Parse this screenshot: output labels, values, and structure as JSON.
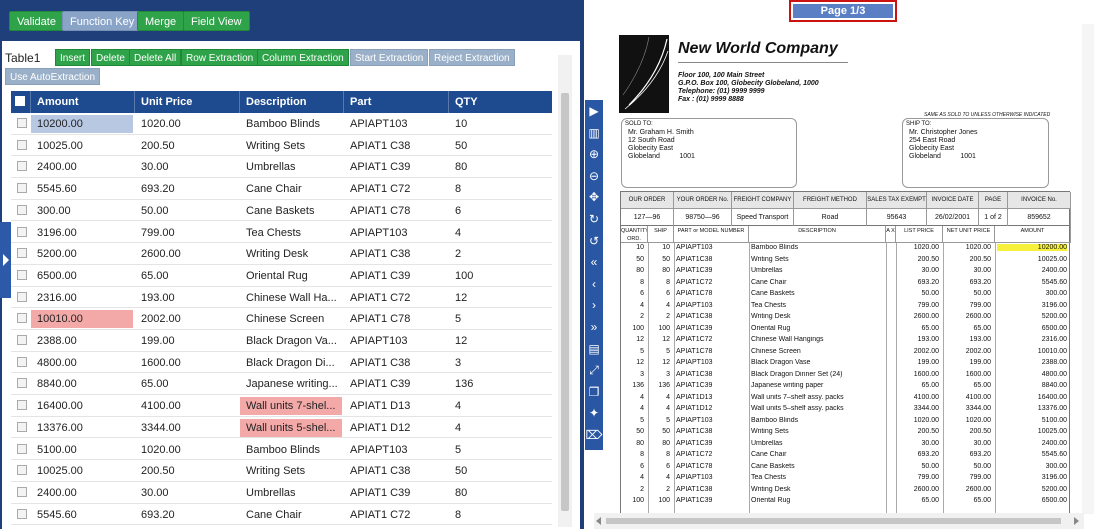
{
  "toolbar": {
    "buttons": [
      "Validate",
      "Function Key",
      "Merge",
      "Field View"
    ]
  },
  "table_controls": {
    "label": "Table1",
    "buttons": [
      "Insert",
      "Delete",
      "Delete All",
      "Row Extraction",
      "Column Extraction",
      "Start Extraction",
      "Reject Extraction",
      "Use AutoExtraction"
    ]
  },
  "grid": {
    "columns": [
      "Amount",
      "Unit Price",
      "Description",
      "Part",
      "QTY"
    ],
    "rows": [
      [
        "10200.00",
        "1020.00",
        "Bamboo Blinds",
        "APIAPT103",
        "10"
      ],
      [
        "10025.00",
        "200.50",
        "Writing Sets",
        "APIAT1 C38",
        "50"
      ],
      [
        "2400.00",
        "30.00",
        "Umbrellas",
        "APIAT1 C39",
        "80"
      ],
      [
        "5545.60",
        "693.20",
        "Cane Chair",
        "APIAT1 C72",
        "8"
      ],
      [
        "300.00",
        "50.00",
        "Cane Baskets",
        "APIAT1 C78",
        "6"
      ],
      [
        "3196.00",
        "799.00",
        "Tea Chests",
        "APIAPT103",
        "4"
      ],
      [
        "5200.00",
        "2600.00",
        "Writing Desk",
        "APIAT1 C38",
        "2"
      ],
      [
        "6500.00",
        "65.00",
        "Oriental Rug",
        "APIAT1 C39",
        "100"
      ],
      [
        "2316.00",
        "193.00",
        "Chinese Wall Ha...",
        "APIAT1 C72",
        "12"
      ],
      [
        "10010.00",
        "2002.00",
        "Chinese Screen",
        "APIAT1 C78",
        "5"
      ],
      [
        "2388.00",
        "199.00",
        "Black Dragon Va...",
        "APIAPT103",
        "12"
      ],
      [
        "4800.00",
        "1600.00",
        "Black Dragon Di...",
        "APIAT1 C38",
        "3"
      ],
      [
        "8840.00",
        "65.00",
        "Japanese writing...",
        "APIAT1 C39",
        "136"
      ],
      [
        "16400.00",
        "4100.00",
        "Wall units 7-shel...",
        "APIAT1 D13",
        "4"
      ],
      [
        "13376.00",
        "3344.00",
        "Wall units 5-shel...",
        "APIAT1 D12",
        "4"
      ],
      [
        "5100.00",
        "1020.00",
        "Bamboo Blinds",
        "APIAPT103",
        "5"
      ],
      [
        "10025.00",
        "200.50",
        "Writing Sets",
        "APIAT1 C38",
        "50"
      ],
      [
        "2400.00",
        "30.00",
        "Umbrellas",
        "APIAT1 C39",
        "80"
      ],
      [
        "5545.60",
        "693.20",
        "Cane Chair",
        "APIAT1 C72",
        "8"
      ]
    ]
  },
  "viewer": {
    "page_indicator": "Page 1/3",
    "company": "New World Company",
    "address": [
      "Floor 100, 100 Main Street",
      "G.P.O. Box 100, Globecity Globeland, 1000",
      "Telephone: (01) 9999 9999",
      "Fax : (01) 9999 8888"
    ],
    "sold_to_label": "SOLD TO:",
    "sold_to": [
      "Mr. Graham H. Smith",
      "12 South Road",
      "Globecity East",
      "Globeland          1001"
    ],
    "ship_note": "SAME AS SOLD TO UNLESS OTHERWISE INDICATED",
    "ship_to_label": "SHIP TO:",
    "ship_to": [
      "Mr. Christopher Jones",
      "254 East Road",
      "Globecity East",
      "Globeland          1001"
    ],
    "order_headers": [
      "OUR ORDER",
      "YOUR ORDER No.",
      "FREIGHT COMPANY",
      "FREIGHT METHOD",
      "SALES TAX EXEMPT",
      "INVOICE DATE",
      "PAGE",
      "INVOICE No."
    ],
    "order_values": [
      "127—96",
      "98750—96",
      "Speed Transport",
      "Road",
      "95643",
      "26/02/2001",
      "1 of 2",
      "859652"
    ],
    "item_headers": [
      "QUANTITY ORD.",
      "SHIP",
      "PART or MODEL NUMBER",
      "DESCRIPTION",
      "A X",
      "LIST PRICE",
      "NET UNIT PRICE",
      "AMOUNT"
    ],
    "items": [
      [
        "10",
        "10",
        "APIAPT103",
        "Bamboo Blinds",
        "1020.00",
        "1020.00",
        "10200.00"
      ],
      [
        "50",
        "50",
        "APIAT1C38",
        "Writing Sets",
        "200.50",
        "200.50",
        "10025.00"
      ],
      [
        "80",
        "80",
        "APIAT1C39",
        "Umbrellas",
        "30.00",
        "30.00",
        "2400.00"
      ],
      [
        "8",
        "8",
        "APIAT1C72",
        "Cane Chair",
        "693.20",
        "693.20",
        "5545.60"
      ],
      [
        "6",
        "6",
        "APIAT1C78",
        "Cane Baskets",
        "50.00",
        "50.00",
        "300.00"
      ],
      [
        "4",
        "4",
        "APIAPT103",
        "Tea Chests",
        "799.00",
        "799.00",
        "3196.00"
      ],
      [
        "2",
        "2",
        "APIAT1C38",
        "Writing Desk",
        "2600.00",
        "2600.00",
        "5200.00"
      ],
      [
        "100",
        "100",
        "APIAT1C39",
        "Oriental Rug",
        "65.00",
        "65.00",
        "6500.00"
      ],
      [
        "12",
        "12",
        "APIAT1C72",
        "Chinese Wall Hangings",
        "193.00",
        "193.00",
        "2316.00"
      ],
      [
        "5",
        "5",
        "APIAT1C78",
        "Chinese Screen",
        "2002.00",
        "2002.00",
        "10010.00"
      ],
      [
        "12",
        "12",
        "APIAPT103",
        "Black Dragon Vase",
        "199.00",
        "199.00",
        "2388.00"
      ],
      [
        "3",
        "3",
        "APIAT1C38",
        "Black Dragon Dinner Set (24)",
        "1600.00",
        "1600.00",
        "4800.00"
      ],
      [
        "136",
        "136",
        "APIAT1C39",
        "Japanese writing paper",
        "65.00",
        "65.00",
        "8840.00"
      ],
      [
        "4",
        "4",
        "APIAT1D13",
        "Wall units 7–shelf assy. packs",
        "4100.00",
        "4100.00",
        "16400.00"
      ],
      [
        "4",
        "4",
        "APIAT1D12",
        "Wall units 5–shelf assy. packs",
        "3344.00",
        "3344.00",
        "13376.00"
      ],
      [
        "5",
        "5",
        "APIAPT103",
        "Bamboo Blinds",
        "1020.00",
        "1020.00",
        "5100.00"
      ],
      [
        "50",
        "50",
        "APIAT1C38",
        "Writing Sets",
        "200.50",
        "200.50",
        "10025.00"
      ],
      [
        "80",
        "80",
        "APIAT1C39",
        "Umbrellas",
        "30.00",
        "30.00",
        "2400.00"
      ],
      [
        "8",
        "8",
        "APIAT1C72",
        "Cane Chair",
        "693.20",
        "693.20",
        "5545.60"
      ],
      [
        "6",
        "6",
        "APIAT1C78",
        "Cane Baskets",
        "50.00",
        "50.00",
        "300.00"
      ],
      [
        "4",
        "4",
        "APIAPT103",
        "Tea Chests",
        "799.00",
        "799.00",
        "3196.00"
      ],
      [
        "2",
        "2",
        "APIAT1C38",
        "Writing Desk",
        "2600.00",
        "2600.00",
        "5200.00"
      ],
      [
        "100",
        "100",
        "APIAT1C39",
        "Oriental Rug",
        "65.00",
        "65.00",
        "6500.00"
      ]
    ]
  },
  "colors": {
    "accent": "#1e4b8f",
    "green": "#2fa34a",
    "highlight_blue": "#b8c8e2",
    "highlight_red": "#f4a9a9",
    "doc_highlight": "#f7f03a"
  },
  "viewer_tools": [
    "play-icon",
    "columns-icon",
    "zoom-in-icon",
    "zoom-out-icon",
    "move-icon",
    "rotate-right-icon",
    "rotate-left-icon",
    "first-page-icon",
    "prev-page-icon",
    "next-page-icon",
    "last-page-icon",
    "document-icon",
    "expand-icon",
    "copy-icon",
    "pin-icon",
    "trash-icon"
  ]
}
